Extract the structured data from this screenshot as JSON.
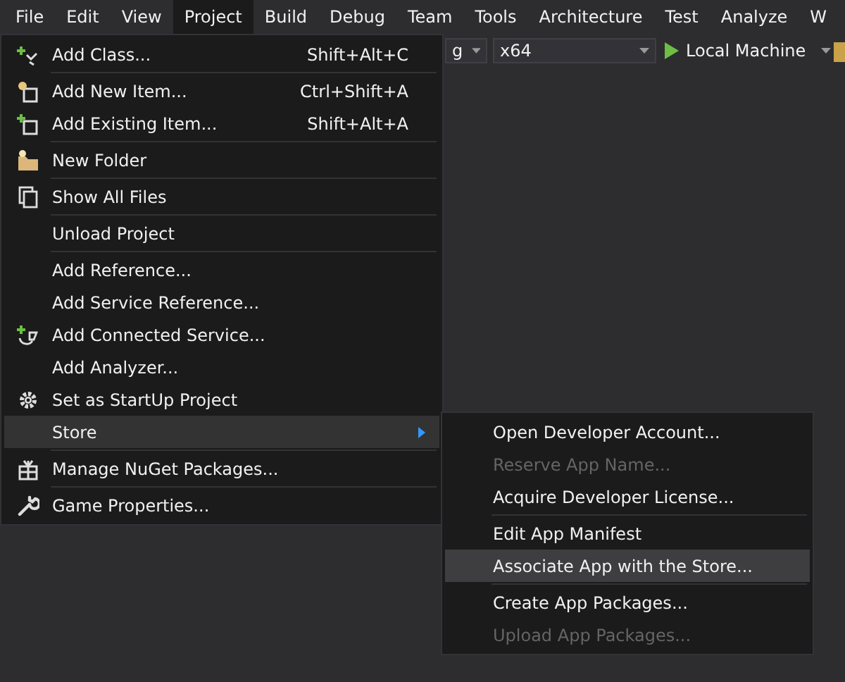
{
  "menu_bar": [
    {
      "label": "File",
      "selected": false
    },
    {
      "label": "Edit",
      "selected": false
    },
    {
      "label": "View",
      "selected": false
    },
    {
      "label": "Project",
      "selected": true
    },
    {
      "label": "Build",
      "selected": false
    },
    {
      "label": "Debug",
      "selected": false
    },
    {
      "label": "Team",
      "selected": false
    },
    {
      "label": "Tools",
      "selected": false
    },
    {
      "label": "Architecture",
      "selected": false
    },
    {
      "label": "Test",
      "selected": false
    },
    {
      "label": "Analyze",
      "selected": false
    },
    {
      "label": "W",
      "selected": false
    }
  ],
  "toolbar": {
    "configuration": "g",
    "platform": "x64",
    "target": "Local Machine"
  },
  "project_menu": [
    [
      {
        "label": "Add Class...",
        "shortcut": "Shift+Alt+C",
        "selected": false,
        "disabled": false,
        "submenu": false
      }
    ],
    [
      {
        "label": "Add New Item...",
        "shortcut": "Ctrl+Shift+A",
        "selected": false,
        "disabled": false,
        "submenu": false
      },
      {
        "label": "Add Existing Item...",
        "shortcut": "Shift+Alt+A",
        "selected": false,
        "disabled": false,
        "submenu": false
      }
    ],
    [
      {
        "label": "New Folder",
        "selected": false,
        "disabled": false,
        "submenu": false
      }
    ],
    [
      {
        "label": "Show All Files",
        "selected": false,
        "disabled": false,
        "submenu": false
      }
    ],
    [
      {
        "label": "Unload Project",
        "selected": false,
        "disabled": false,
        "submenu": false
      }
    ],
    [
      {
        "label": "Add Reference...",
        "selected": false,
        "disabled": false,
        "submenu": false
      },
      {
        "label": "Add Service Reference...",
        "selected": false,
        "disabled": false,
        "submenu": false
      },
      {
        "label": "Add Connected Service...",
        "selected": false,
        "disabled": false,
        "submenu": false
      },
      {
        "label": "Add Analyzer...",
        "selected": false,
        "disabled": false,
        "submenu": false
      },
      {
        "label": "Set as StartUp Project",
        "selected": false,
        "disabled": false,
        "submenu": false
      },
      {
        "label": "Store",
        "selected": true,
        "disabled": false,
        "submenu": true
      }
    ],
    [
      {
        "label": "Manage NuGet Packages...",
        "selected": false,
        "disabled": false,
        "submenu": false
      }
    ],
    [
      {
        "label": "Game Properties...",
        "selected": false,
        "disabled": false,
        "submenu": false
      }
    ]
  ],
  "store_submenu": [
    [
      {
        "label": "Open Developer Account...",
        "selected": false,
        "disabled": false
      },
      {
        "label": "Reserve App Name...",
        "selected": false,
        "disabled": true
      },
      {
        "label": "Acquire Developer License...",
        "selected": false,
        "disabled": false
      }
    ],
    [
      {
        "label": "Edit App Manifest",
        "selected": false,
        "disabled": false
      },
      {
        "label": "Associate App with the Store...",
        "selected": true,
        "disabled": false
      }
    ],
    [
      {
        "label": "Create App Packages...",
        "selected": false,
        "disabled": false
      },
      {
        "label": "Upload App Packages...",
        "selected": false,
        "disabled": true
      }
    ]
  ]
}
